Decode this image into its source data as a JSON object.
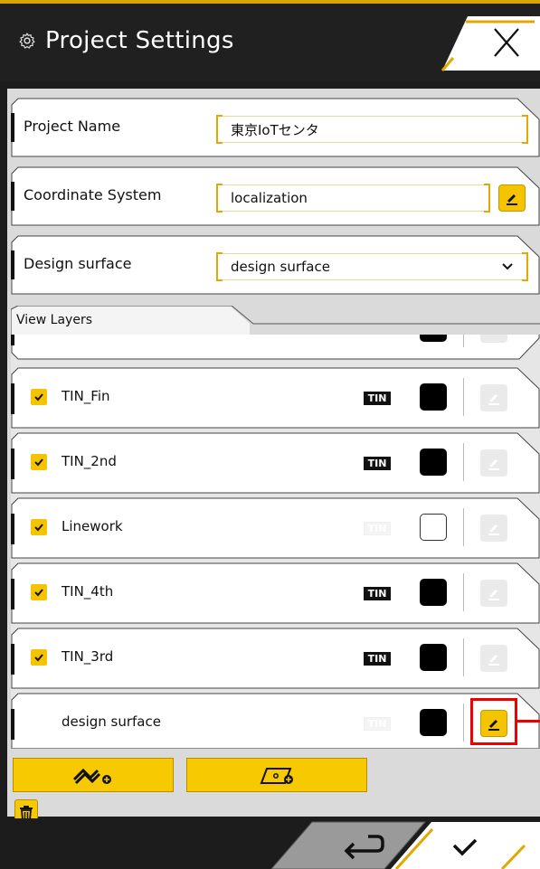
{
  "header": {
    "title": "Project Settings",
    "icon": "gear-icon",
    "close_icon": "close-icon",
    "accent": "#d9a400"
  },
  "form": {
    "project_name_label": "Project Name",
    "project_name_value": "東京IoTセンタ",
    "coordinate_system_label": "Coordinate System",
    "coordinate_system_value": "localization",
    "design_surface_label": "Design surface",
    "design_surface_value": "design surface"
  },
  "layers": {
    "title": "View Layers",
    "items": [
      {
        "name": "TIN_Fin",
        "checked": true,
        "tin_active": true,
        "tin_label": "TIN",
        "color": "#000000",
        "filled": true,
        "edit_active": false
      },
      {
        "name": "TIN_2nd",
        "checked": true,
        "tin_active": true,
        "tin_label": "TIN",
        "color": "#000000",
        "filled": true,
        "edit_active": false
      },
      {
        "name": "Linework",
        "checked": true,
        "tin_active": false,
        "tin_label": "TIN",
        "color": "#ffffff",
        "filled": false,
        "edit_active": false
      },
      {
        "name": "TIN_4th",
        "checked": true,
        "tin_active": true,
        "tin_label": "TIN",
        "color": "#000000",
        "filled": true,
        "edit_active": false
      },
      {
        "name": "TIN_3rd",
        "checked": true,
        "tin_active": true,
        "tin_label": "TIN",
        "color": "#000000",
        "filled": true,
        "edit_active": false
      },
      {
        "name": "design surface",
        "checked": false,
        "tin_active": false,
        "tin_label": "TIN",
        "color": "#000000",
        "filled": true,
        "edit_active": true
      }
    ]
  },
  "actions": {
    "add_line_icon": "add-linework-icon",
    "add_surface_icon": "add-surface-icon",
    "delete_icon": "trash-icon",
    "back_icon": "return-icon",
    "confirm_icon": "checkmark-icon"
  }
}
